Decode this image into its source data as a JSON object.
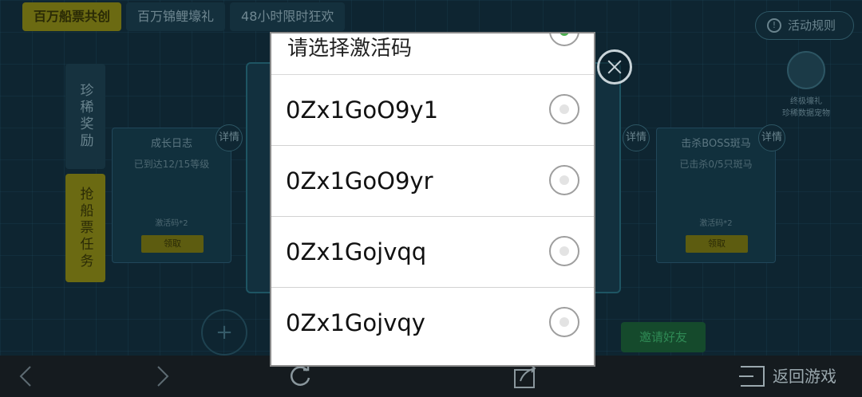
{
  "game": {
    "tabs": [
      "百万船票共创",
      "百万锦鲤壕礼",
      "48小时限时狂欢"
    ],
    "rules_label": "活动规则",
    "side_rare": "珍稀奖励",
    "side_task": "抢船票任务",
    "cards": [
      {
        "title": "成长日志",
        "status": "已到达12/15等级",
        "reward": "激活码*2",
        "claim": "领取"
      },
      {
        "title": "击杀BOSS斑马",
        "status": "已击杀0/5只斑马",
        "reward": "激活码*2",
        "claim": "领取"
      }
    ],
    "detail_label": "详情",
    "ultimate_title": "终极壕礼",
    "ultimate_sub": "珍稀数据宠物",
    "invite_label": "邀请好友",
    "plus_label": "+"
  },
  "browser": {
    "back_icon": "chevron-left-icon",
    "forward_icon": "chevron-right-icon",
    "refresh_icon": "refresh-icon",
    "share_icon": "share-icon",
    "return_label": "返回游戏"
  },
  "dialog": {
    "title": "请选择激活码",
    "options": [
      "0Zx1GoO9y1",
      "0Zx1GoO9yr",
      "0Zx1Gojvqq",
      "0Zx1Gojvqy"
    ]
  }
}
